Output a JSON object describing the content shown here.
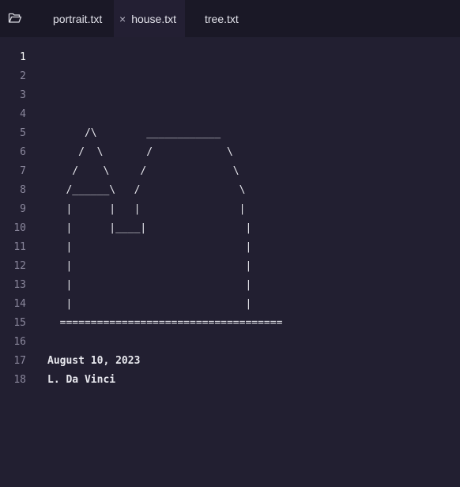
{
  "tabs": [
    {
      "label": "portrait.txt"
    },
    {
      "label": "house.txt",
      "close": "×"
    },
    {
      "label": "tree.txt"
    }
  ],
  "editor": {
    "line_numbers": [
      "1",
      "2",
      "3",
      "4",
      "5",
      "6",
      "7",
      "8",
      "9",
      "10",
      "11",
      "12",
      "13",
      "14",
      "15",
      "16",
      "17",
      "18"
    ],
    "lines": [
      "",
      "",
      "",
      "",
      "      /\\        ____________",
      "     /  \\       /            \\",
      "    /    \\     /              \\",
      "   /______\\   /                \\",
      "   |      |   |                |",
      "   |      |____|                |",
      "   |                            |",
      "   |                            |",
      "   |                            |",
      "   |                            |",
      "  ====================================",
      "",
      "August 10, 2023",
      "L. Da Vinci"
    ]
  }
}
